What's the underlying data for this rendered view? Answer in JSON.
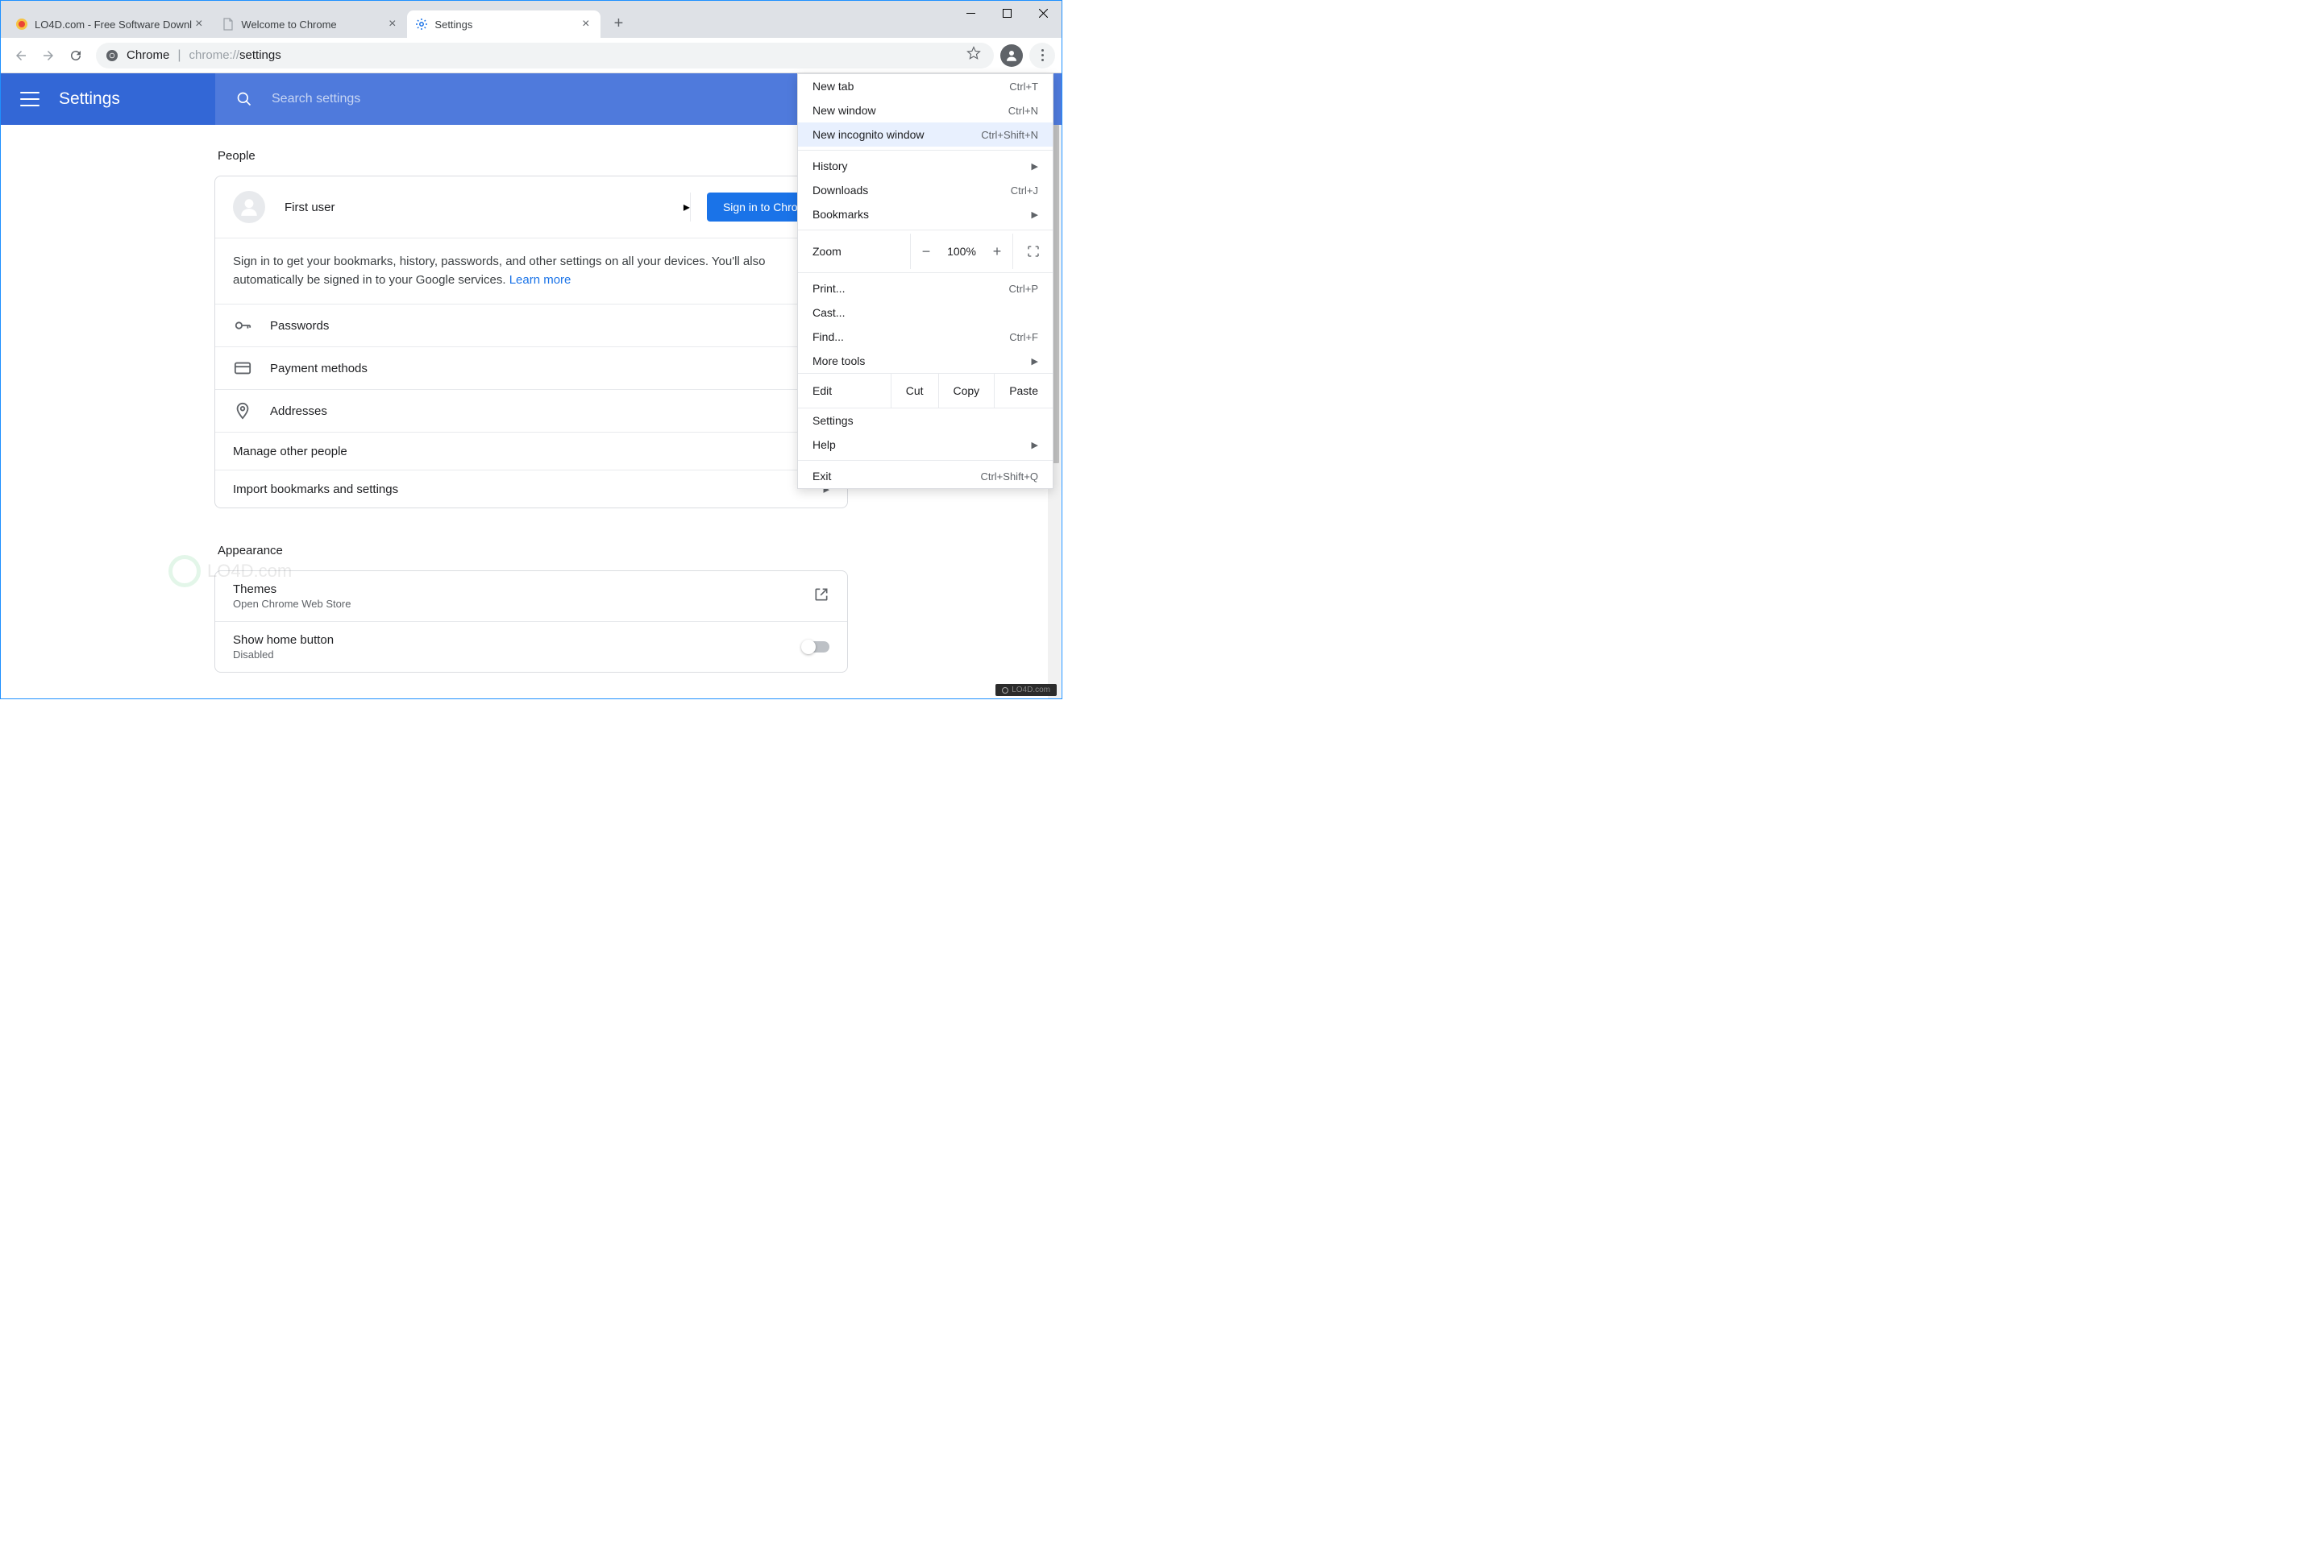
{
  "tabs": [
    {
      "title": "LO4D.com - Free Software Downl",
      "favicon": "lo4d"
    },
    {
      "title": "Welcome to Chrome",
      "favicon": "doc"
    },
    {
      "title": "Settings",
      "favicon": "gear",
      "active": true
    }
  ],
  "omnibox": {
    "prefix": "Chrome",
    "url_dim": "chrome://",
    "url_bold": "settings"
  },
  "header": {
    "title": "Settings",
    "search_placeholder": "Search settings",
    "watermark": "LO4D.com"
  },
  "people": {
    "section_title": "People",
    "user_name": "First user",
    "signin_button": "Sign in to Chrome",
    "desc": "Sign in to get your bookmarks, history, passwords, and other settings on all your devices. You'll also automatically be signed in to your Google services.",
    "learn_more": "Learn more",
    "rows": {
      "passwords": "Passwords",
      "payment": "Payment methods",
      "addresses": "Addresses",
      "manage": "Manage other people",
      "import": "Import bookmarks and settings"
    }
  },
  "appearance": {
    "section_title": "Appearance",
    "themes": "Themes",
    "themes_sub": "Open Chrome Web Store",
    "home_btn": "Show home button",
    "home_sub": "Disabled"
  },
  "menu": {
    "new_tab": "New tab",
    "new_tab_sc": "Ctrl+T",
    "new_window": "New window",
    "new_window_sc": "Ctrl+N",
    "incognito": "New incognito window",
    "incognito_sc": "Ctrl+Shift+N",
    "history": "History",
    "downloads": "Downloads",
    "downloads_sc": "Ctrl+J",
    "bookmarks": "Bookmarks",
    "zoom_label": "Zoom",
    "zoom_value": "100%",
    "print": "Print...",
    "print_sc": "Ctrl+P",
    "cast": "Cast...",
    "find": "Find...",
    "find_sc": "Ctrl+F",
    "more_tools": "More tools",
    "edit": "Edit",
    "cut": "Cut",
    "copy": "Copy",
    "paste": "Paste",
    "settings": "Settings",
    "help": "Help",
    "exit": "Exit",
    "exit_sc": "Ctrl+Shift+Q"
  },
  "footer_badge": "LO4D.com",
  "watermark2": "LO4D.com"
}
